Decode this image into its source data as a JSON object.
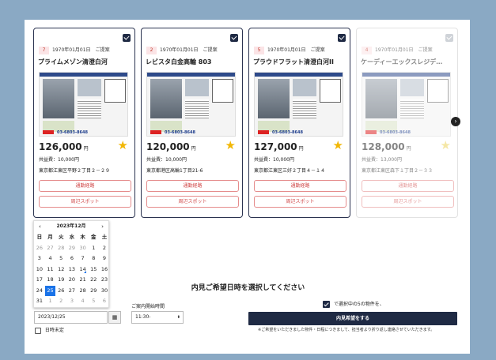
{
  "cards": [
    {
      "num": "7",
      "date": "1970年01月01日",
      "tag": "ご提案",
      "name": "プライムメゾン清澄白河",
      "price": "126,000",
      "yen": "円",
      "fee": "共益費：10,000円",
      "address": "東京都江東区平野２丁目２－２９",
      "route_label": "通勤経路",
      "spot_label": "周辺スポット",
      "phone": "03-6803-8648",
      "faded": false
    },
    {
      "num": "2",
      "date": "1970年01月01日",
      "tag": "ご提案",
      "name": "レビスタ白金高輪 803",
      "price": "120,000",
      "yen": "円",
      "fee": "共益費：10,000円",
      "address": "東京都港区高輪1丁目21-6",
      "route_label": "通勤経路",
      "spot_label": "周辺スポット",
      "phone": "03-6803-8648",
      "faded": false
    },
    {
      "num": "5",
      "date": "1970年01月01日",
      "tag": "ご提案",
      "name": "プラウドフラット清澄白河II",
      "price": "127,000",
      "yen": "円",
      "fee": "共益費：10,000円",
      "address": "東京都江東区三好２丁目４－１４",
      "route_label": "通勤経路",
      "spot_label": "周辺スポット",
      "phone": "03-6803-8648",
      "faded": false
    },
    {
      "num": "4",
      "date": "1970年01月01日",
      "tag": "ご提案",
      "name": "ケーディーエックスレジデ…",
      "price": "128,000",
      "yen": "円",
      "fee": "共益費：13,000円",
      "address": "東京都江東区森下１丁目２－３３",
      "route_label": "通勤経路",
      "spot_label": "周辺スポット",
      "phone": "03-6803-8648",
      "faded": true
    }
  ],
  "schedule": {
    "title": "内見ご希望日時を選択してください",
    "time_label": "ご案内開始時間",
    "date_value": "2023/12/25",
    "time_value": "11:30-",
    "undecided_label": "日時未定",
    "confirm_label": "で選択中の5の物件を、",
    "submit_label": "内見希望をする",
    "note": "※ご希望をいただきました物件・日程につきまして、担当者より折り返し連絡させていただきます。"
  },
  "calendar": {
    "header": "2023年12月",
    "weekdays": [
      "日",
      "月",
      "火",
      "水",
      "木",
      "金",
      "土"
    ],
    "rows": [
      [
        "26",
        "27",
        "28",
        "29",
        "30",
        "1",
        "2"
      ],
      [
        "3",
        "4",
        "5",
        "6",
        "7",
        "8",
        "9"
      ],
      [
        "10",
        "11",
        "12",
        "13",
        "14",
        "15",
        "16"
      ],
      [
        "17",
        "18",
        "19",
        "20",
        "21",
        "22",
        "23"
      ],
      [
        "24",
        "25",
        "26",
        "27",
        "28",
        "29",
        "30"
      ],
      [
        "31",
        "1",
        "2",
        "3",
        "4",
        "5",
        "6"
      ]
    ],
    "selected": "25",
    "today": "14"
  },
  "colors": {
    "navy": "#1f2a44",
    "accent_red": "#d04848",
    "star": "#f2b705",
    "page_bg": "#8aa9c4",
    "selected_day": "#1a73e8"
  }
}
